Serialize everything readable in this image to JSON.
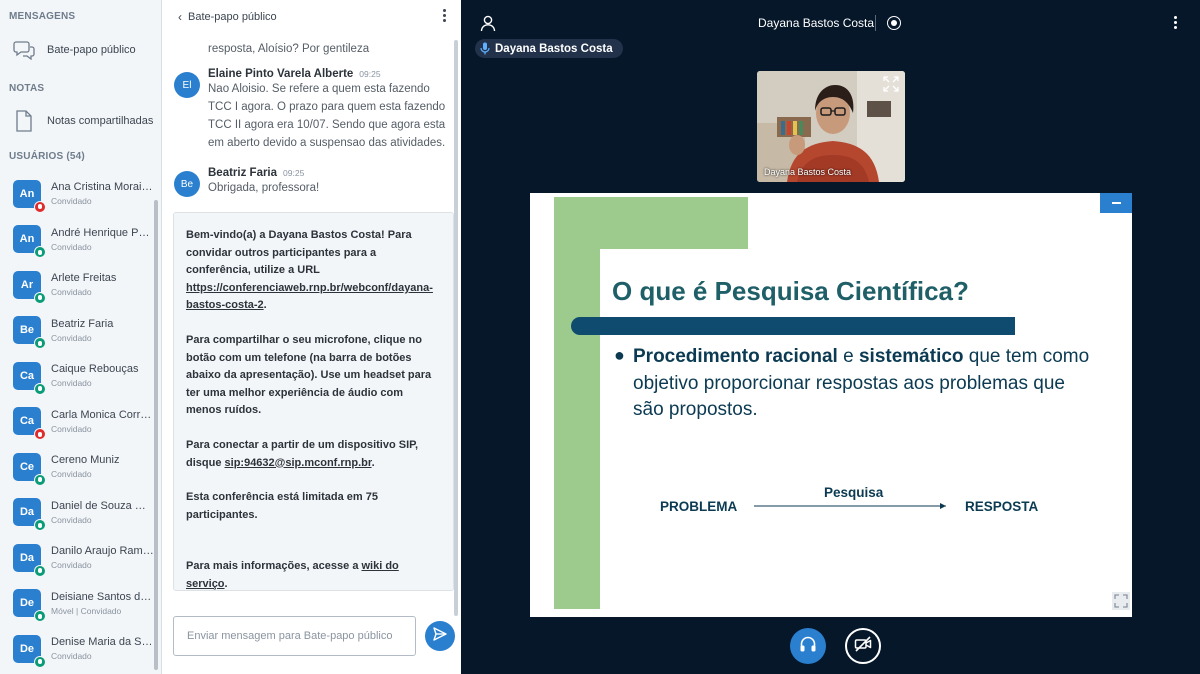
{
  "sidebar": {
    "messages_title": "MENSAGENS",
    "public_chat_label": "Bate-papo público",
    "notes_title": "NOTAS",
    "shared_notes_label": "Notas compartilhadas",
    "users_title": "USUÁRIOS (54)",
    "users": [
      {
        "initials": "An",
        "name": "Ana Cristina Morais ...",
        "role": "Convidado",
        "status": "muted"
      },
      {
        "initials": "An",
        "name": "André Henrique Per...",
        "role": "Convidado",
        "status": "listen"
      },
      {
        "initials": "Ar",
        "name": "Arlete Freitas",
        "role": "Convidado",
        "status": "listen"
      },
      {
        "initials": "Be",
        "name": "Beatriz Faria",
        "role": "Convidado",
        "status": "listen"
      },
      {
        "initials": "Ca",
        "name": "Caique Rebouças",
        "role": "Convidado",
        "status": "listen"
      },
      {
        "initials": "Ca",
        "name": "Carla Monica Correi...",
        "role": "Convidado",
        "status": "muted"
      },
      {
        "initials": "Ce",
        "name": "Cereno Muniz",
        "role": "Convidado",
        "status": "listen"
      },
      {
        "initials": "Da",
        "name": "Daniel de Souza Ma...",
        "role": "Convidado",
        "status": "listen"
      },
      {
        "initials": "Da",
        "name": "Danilo Araujo Rama...",
        "role": "Convidado",
        "status": "listen"
      },
      {
        "initials": "De",
        "name": "Deisiane Santos da ...",
        "role": "Móvel | Convidado",
        "status": "listen"
      },
      {
        "initials": "De",
        "name": "Denise Maria da Sil...",
        "role": "Convidado",
        "status": "listen"
      }
    ]
  },
  "chat": {
    "title": "Bate-papo público",
    "prev_fragment": "resposta, Aloísio? Por gentileza",
    "messages": [
      {
        "initials": "El",
        "name": "Elaine Pinto Varela Alberte",
        "time": "09:25",
        "text": "Nao Aloisio. Se refere a quem esta fazendo TCC I agora. O prazo para quem esta fazendo TCC II agora era 10/07. Sendo que agora esta em aberto devido a suspensao das atividades."
      },
      {
        "initials": "Be",
        "name": "Beatriz Faria",
        "time": "09:25",
        "text": "Obrigada, professora!"
      }
    ],
    "welcome": {
      "p1_a": "Bem-vindo(a) a ",
      "p1_b": "Dayana Bastos Costa",
      "p1_c": "! Para convidar outros participantes para a conferência, utilize a URL ",
      "p1_link": "https://conferenciaweb.rnp.br/webconf/dayana-bastos-costa-2",
      "p1_d": ".",
      "p2": "Para compartilhar o seu microfone, clique no botão com um telefone (na barra de botões abaixo da apresentação). Use um headset para ter uma melhor experiência de áudio com menos ruídos.",
      "p3_a": "Para conectar a partir de um dispositivo SIP, disque ",
      "p3_link": "sip:94632@sip.mconf.rnp.br",
      "p3_b": ".",
      "p4_a": "Esta conferência está limitada em ",
      "p4_b": "75",
      "p4_c": " participantes.",
      "p5_a": "Para mais informações, acesse a ",
      "p5_link": "wiki do serviço",
      "p5_b": "."
    },
    "input_placeholder": "Enviar mensagem para Bate-papo público"
  },
  "main": {
    "meeting_title": "Dayana Bastos Costa",
    "talking_indicator": "Dayana Bastos Costa",
    "webcam_name": "Dayana Bastos Costa",
    "slide": {
      "title": "O que é Pesquisa Científica?",
      "bullet_b1": "Procedimento racional",
      "bullet_n1": " e ",
      "bullet_b2": "sistemático",
      "bullet_n2": " que tem como objetivo proporcionar respostas aos problemas que são propostos.",
      "flow_left": "PROBLEMA",
      "flow_middle": "Pesquisa",
      "flow_right": "RESPOSTA"
    }
  },
  "colors": {
    "accent": "#2a7fcf",
    "main_bg": "#06172a",
    "slide_green": "#9ccb8d",
    "slide_navy": "#0f4b6f"
  }
}
